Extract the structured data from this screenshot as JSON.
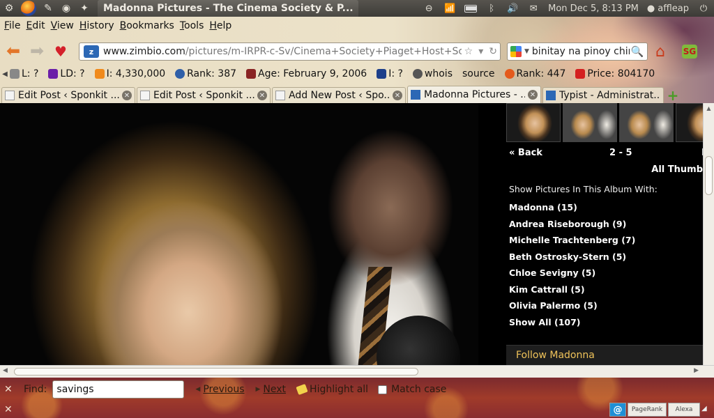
{
  "panel": {
    "window_title": "Madonna Pictures - The Cinema Society & P...",
    "clock": "Mon Dec  5,  8:13 PM",
    "user": "affleap"
  },
  "menu": [
    "File",
    "Edit",
    "View",
    "History",
    "Bookmarks",
    "Tools",
    "Help"
  ],
  "navbar": {
    "url_domain": "www.zimbio.com",
    "url_path": "/pictures/m-IRPR-c-Sv/Cinema+Society+Piaget+Host+Scre",
    "search_value": "binitay na pinoy china",
    "addon_label": "SG"
  },
  "seobar": {
    "items": [
      {
        "label": "L: ?",
        "color": "#888888"
      },
      {
        "label": "LD: ?",
        "color": "#6b1fa8"
      },
      {
        "label": "I: 4,330,000",
        "color": "#f08a1c"
      },
      {
        "label": "Rank: 387",
        "color": "#2f5fa8"
      },
      {
        "label": "Age: February 9, 2006",
        "color": "#8a2424"
      },
      {
        "label": "I: ?",
        "color": "#1d3f8a"
      },
      {
        "label": "whois",
        "color": "#555555"
      },
      {
        "label": "source",
        "color": "#555555"
      },
      {
        "label": "Rank: 447",
        "color": "#e45a1c"
      },
      {
        "label": "Price: 804170",
        "color": "#d42020"
      }
    ]
  },
  "tabs": [
    {
      "label": "Edit Post ‹ Sponkit ...",
      "active": false
    },
    {
      "label": "Edit Post ‹ Sponkit ...",
      "active": false
    },
    {
      "label": "Add New Post ‹ Spo...",
      "active": false
    },
    {
      "label": "Madonna Pictures - ...",
      "active": true
    },
    {
      "label": "Typist - Administrat...",
      "active": false
    }
  ],
  "sidebar": {
    "back_label": "« Back",
    "page_range": "2 - 5",
    "next_label": "N",
    "all_thumbs_label": "All Thumb",
    "album_heading": "Show Pictures In This Album With:",
    "people": [
      "Madonna (15)",
      "Andrea Riseborough (9)",
      "Michelle Trachtenberg (7)",
      "Beth Ostrosky-Stern (5)",
      "Chloe Sevigny (5)",
      "Kim Cattrall (5)",
      "Olivia Palermo (5)",
      "Show All (107)"
    ],
    "follow_label": "Follow Madonna"
  },
  "findbar": {
    "label": "Find:",
    "query": "savings",
    "previous_label": "Previous",
    "next_label": "Next",
    "highlight_label": "Highlight all",
    "match_case_label": "Match case"
  },
  "statusbar": {
    "at_label": "@",
    "pagerank_label": "PageRank",
    "alexa_label": "Alexa"
  }
}
